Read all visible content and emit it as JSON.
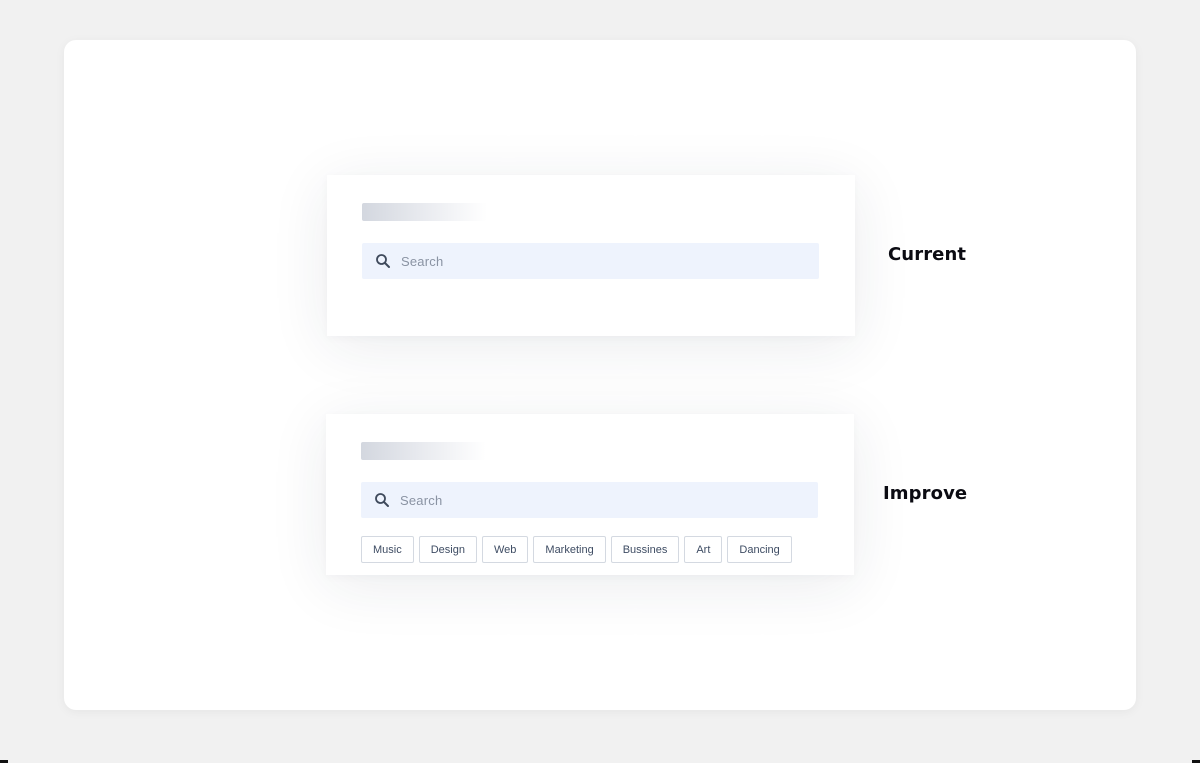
{
  "current": {
    "label": "Current",
    "search": {
      "placeholder": "Search",
      "icon": "search-icon"
    }
  },
  "improve": {
    "label": "Improve",
    "search": {
      "placeholder": "Search",
      "icon": "search-icon"
    },
    "tags": [
      {
        "label": "Music"
      },
      {
        "label": "Design"
      },
      {
        "label": "Web"
      },
      {
        "label": "Marketing"
      },
      {
        "label": "Bussines"
      },
      {
        "label": "Art"
      },
      {
        "label": "Dancing"
      }
    ]
  },
  "colors": {
    "search_background": "#eef3fd",
    "tag_border": "#d4d9e1",
    "label_text": "#0b0b12",
    "page_background": "#f1f1f1"
  }
}
